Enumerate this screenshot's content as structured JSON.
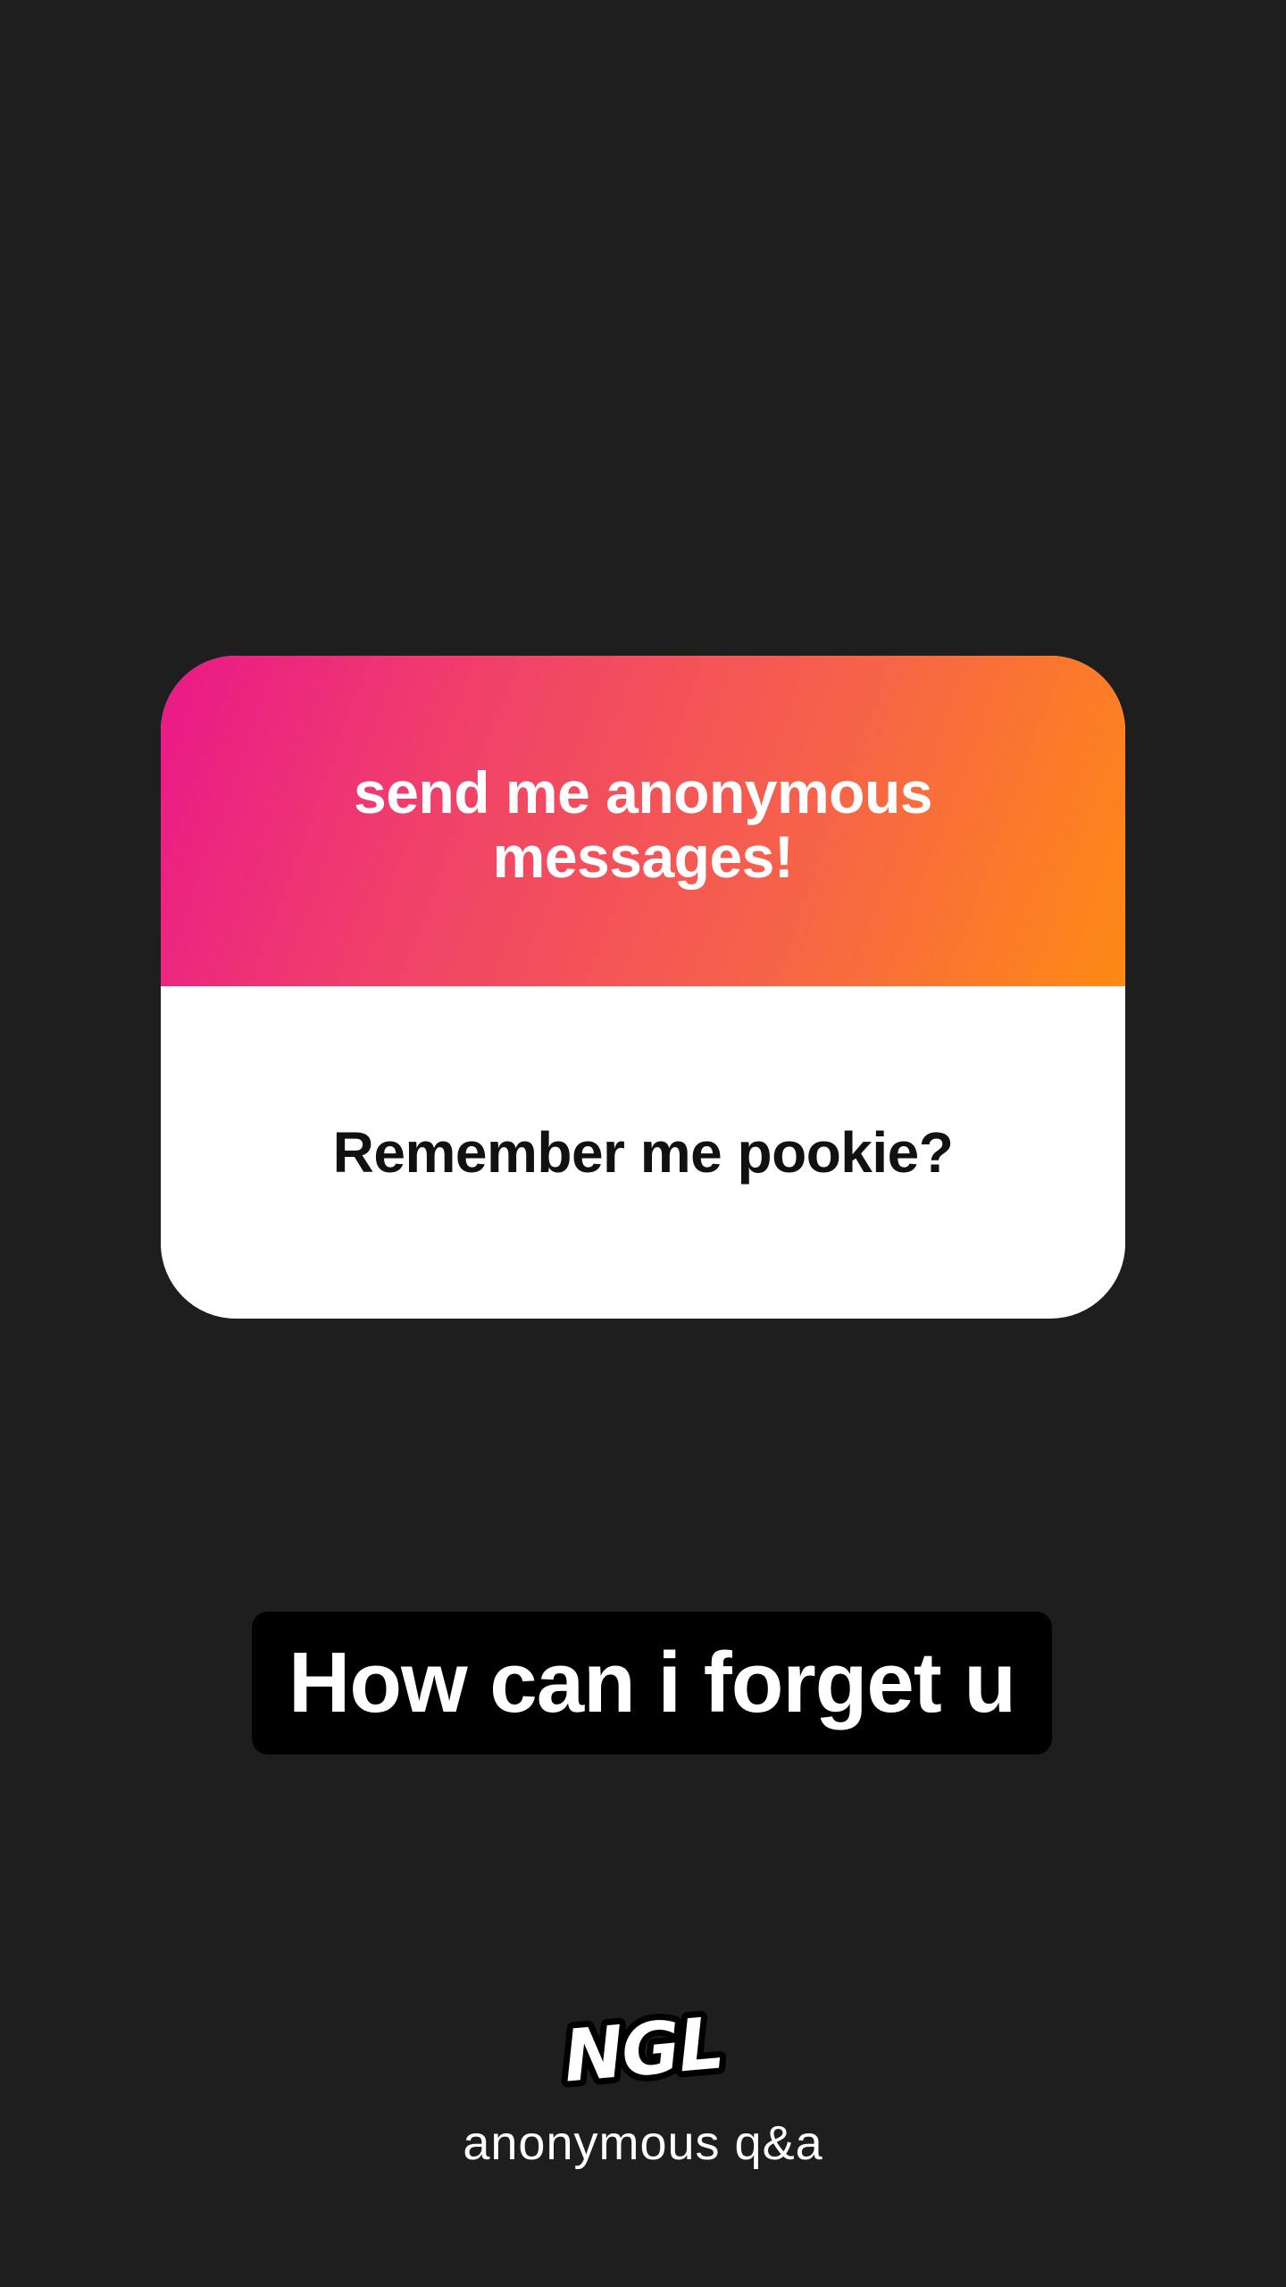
{
  "card": {
    "title": "send me anonymous messages!",
    "message": "Remember me pookie?",
    "gradient_start": "#ea1889",
    "gradient_end": "#ff8a14"
  },
  "reply": {
    "text": "How can i forget u"
  },
  "brand": {
    "logo_text": "NGL",
    "subtitle": "anonymous q&a"
  }
}
